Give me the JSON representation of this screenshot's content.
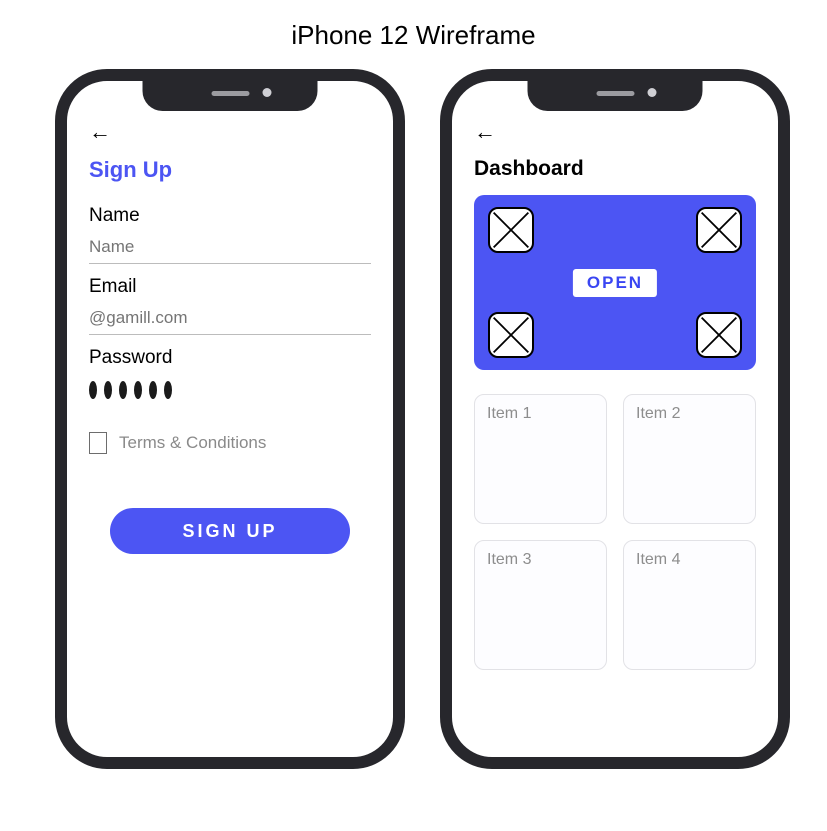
{
  "title": "iPhone 12 Wireframe",
  "signup": {
    "back_glyph": "←",
    "heading": "Sign Up",
    "name_label": "Name",
    "name_placeholder": "Name",
    "email_label": "Email",
    "email_placeholder": "@gamill.com",
    "password_label": "Password",
    "password_dot_count": 6,
    "terms_label": "Terms & Conditions",
    "button_label": "SIGN  UP"
  },
  "dashboard": {
    "back_glyph": "←",
    "heading": "Dashboard",
    "open_label": "OPEN",
    "items": [
      "Item 1",
      "Item 2",
      "Item 3",
      "Item 4"
    ]
  },
  "colors": {
    "accent": "#4c55f3"
  }
}
